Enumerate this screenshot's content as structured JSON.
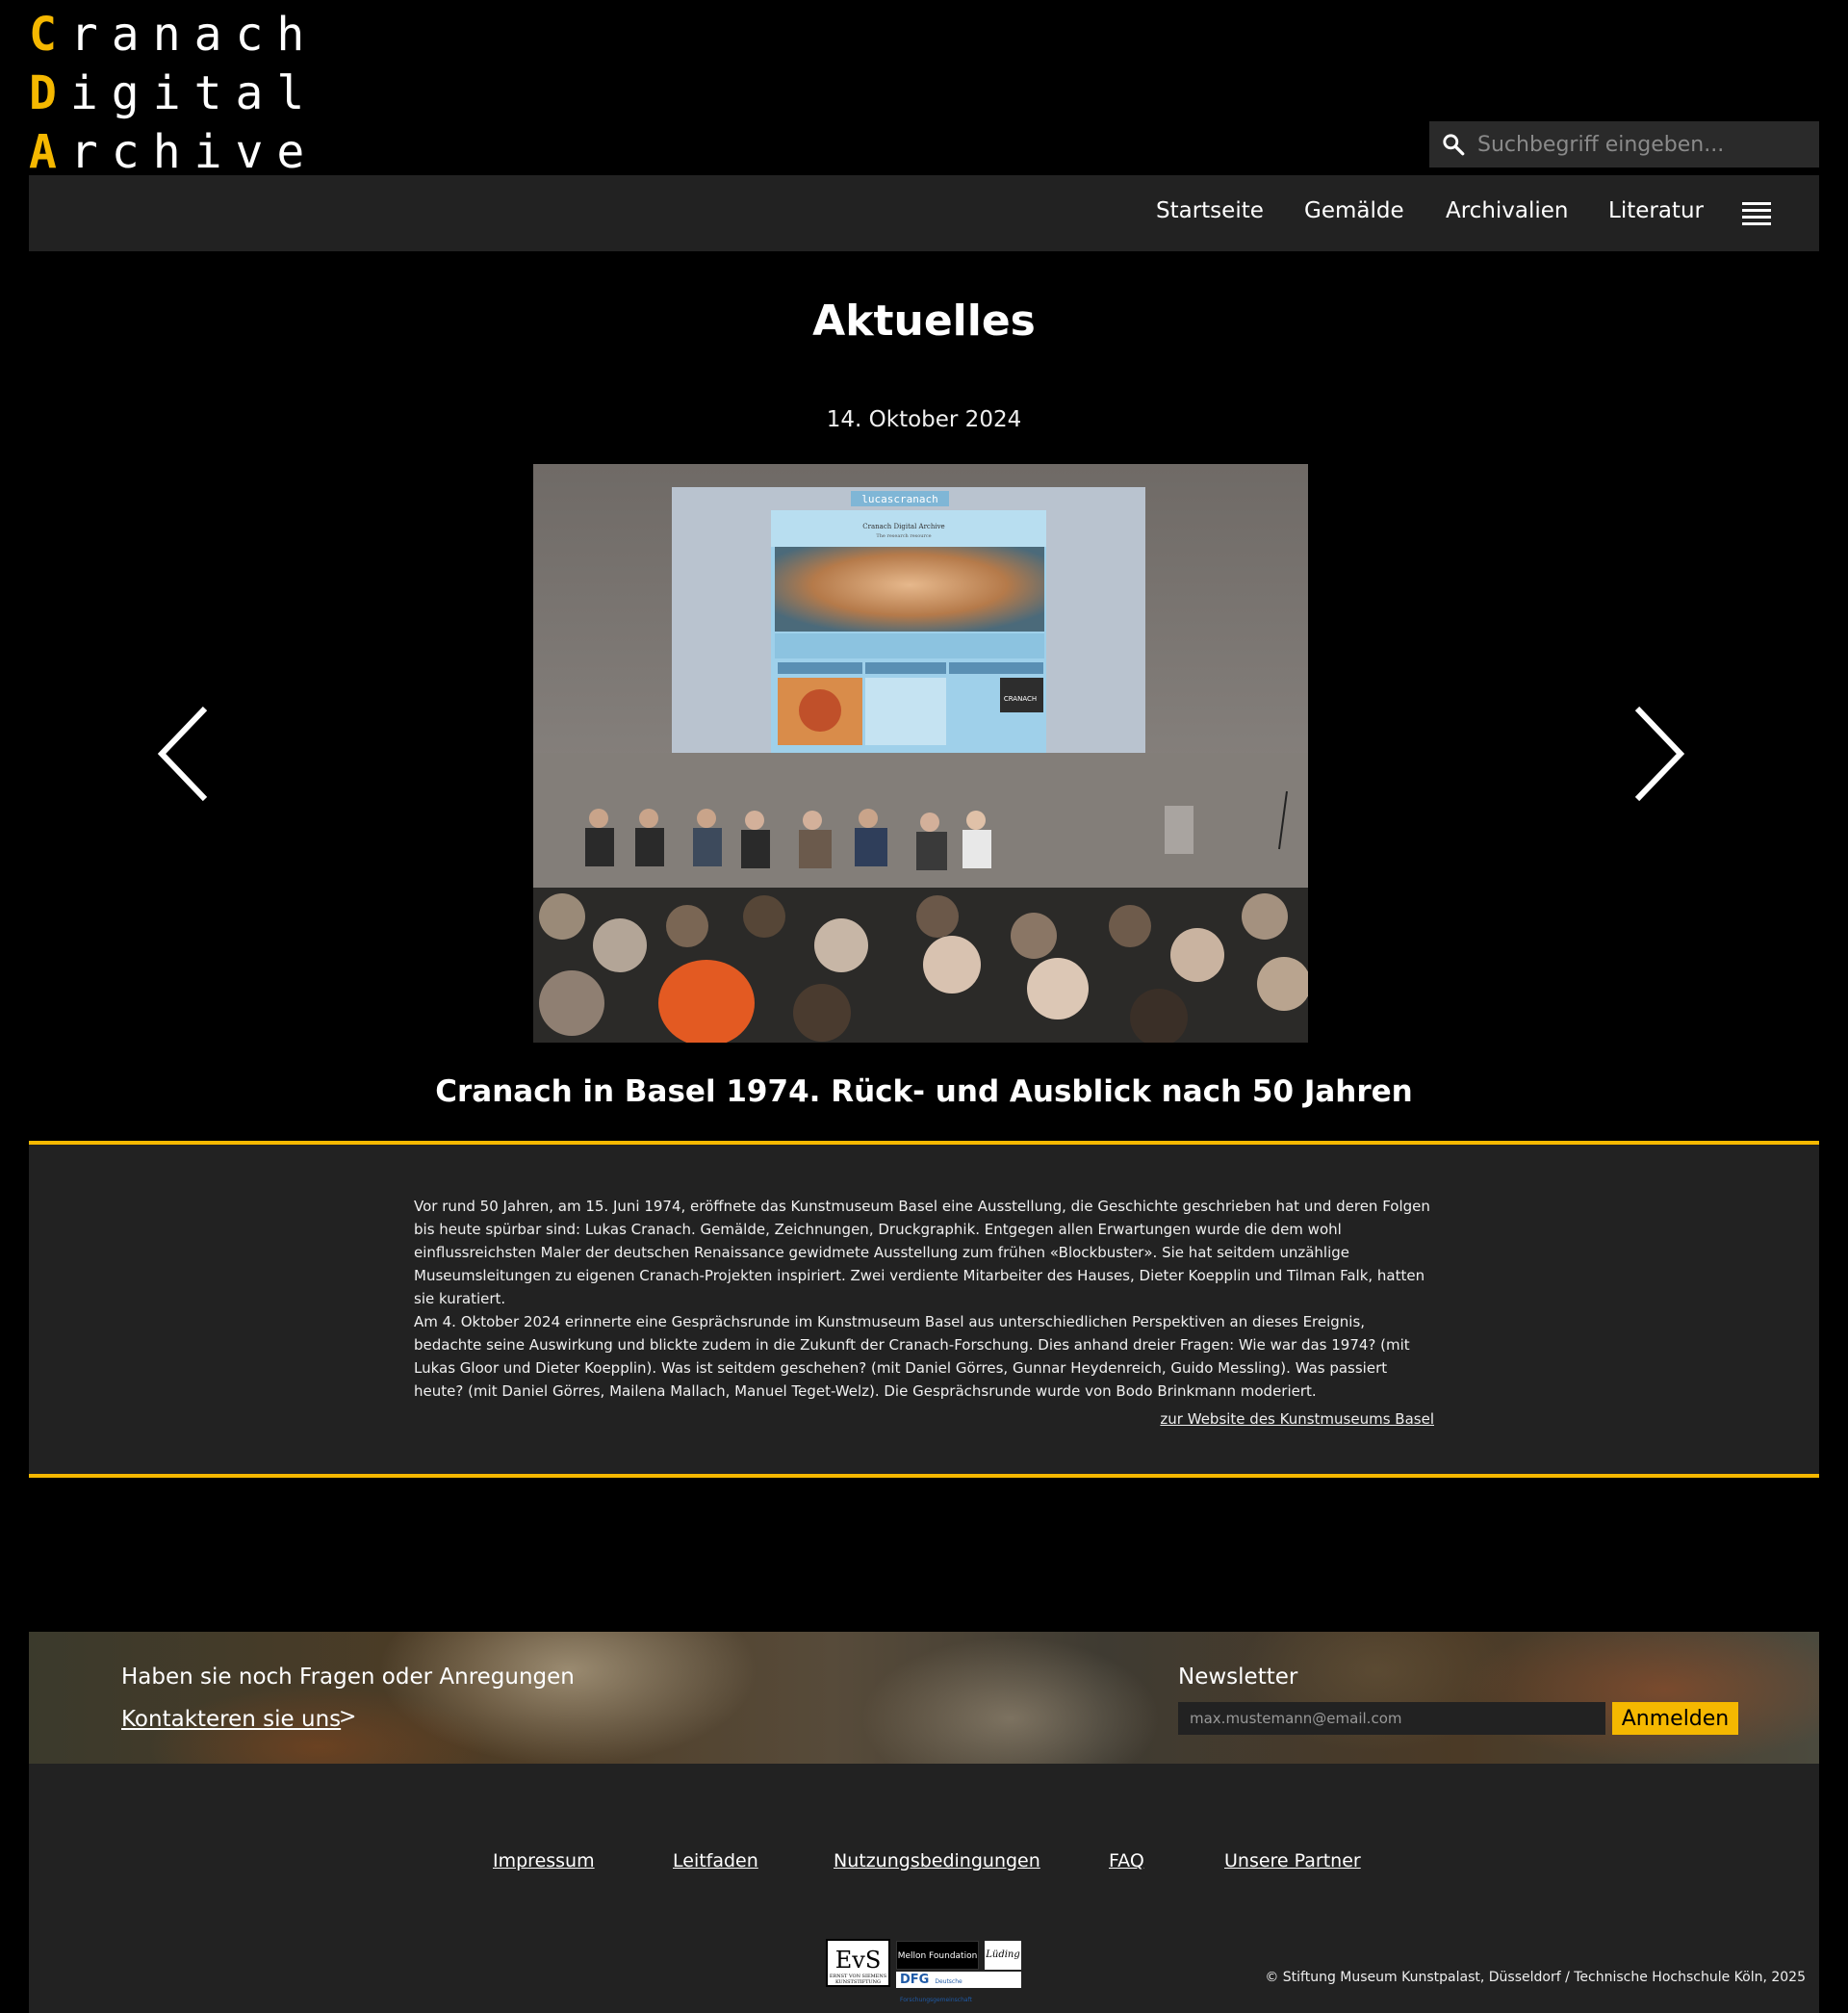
{
  "logo": {
    "line1": {
      "cap": "C",
      "rest": "ranach"
    },
    "line2": {
      "cap": "D",
      "rest": "igital"
    },
    "line3": {
      "cap": "A",
      "rest": "rchive"
    }
  },
  "search": {
    "placeholder": "Suchbegriff eingeben..."
  },
  "nav": {
    "items": [
      {
        "label": "Startseite"
      },
      {
        "label": "Gemälde"
      },
      {
        "label": "Archivalien"
      },
      {
        "label": "Literatur"
      }
    ]
  },
  "main": {
    "title": "Aktuelles",
    "date": "14. Oktober 2024",
    "article_title": "Cranach in Basel 1974. Rück- und Ausblick nach 50 Jahren",
    "paragraph1": "Vor rund 50 Jahren, am 15. Juni 1974, eröffnete das Kunstmuseum Basel eine  Ausstellung, die Geschichte geschrieben hat und deren Folgen bis heute  spürbar sind: Lukas Cranach. Gemälde, Zeichnungen, Druckgraphik. Entgegen allen Erwartungen wurde die dem wohl einflussreichsten Maler der deutschen Renaissance gewidmete Ausstellung zum frühen  «Blockbuster». Sie hat seitdem unzählige Museumsleitungen zu eigenen  Cranach-Projekten inspiriert. Zwei verdiente Mitarbeiter des Hauses,  Dieter Koepplin und Tilman Falk, hatten sie kuratiert.",
    "paragraph2": "Am 4. Oktober 2024 erinnerte eine Gesprächsrunde im Kunstmuseum Basel aus  unterschiedlichen Perspektiven an dieses Ereignis, bedachte seine Auswirkung und blickte zudem in die Zukunft der Cranach-Forschung. Dies  anhand dreier Fragen: Wie war das 1974? (mit Lukas Gloor und Dieter Koepplin). Was ist seitdem geschehen? (mit Daniel Görres, Gunnar  Heydenreich, Guido Messling). Was passiert heute? (mit Daniel Görres,  Mailena Mallach, Manuel Teget-Welz). Die Gesprächsrunde wurde von Bodo  Brinkmann moderiert.",
    "external_link": "zur Website des Kunstmuseums Basel",
    "photo_screen_text": {
      "site": "lucascranach",
      "header": "Cranach Digital Archive",
      "sub": "The research resource",
      "badge": "CRANACH"
    }
  },
  "banner": {
    "question": "Haben sie noch Fragen oder Anregungen",
    "contact_link": "Kontakteren sie uns",
    "chevron": ">",
    "newsletter_label": "Newsletter",
    "newsletter_placeholder": "max.mustemann@email.com",
    "newsletter_button": "Anmelden"
  },
  "footer": {
    "links": [
      {
        "label": "Impressum"
      },
      {
        "label": "Leitfaden"
      },
      {
        "label": "Nutzungsbedingungen"
      },
      {
        "label": "FAQ"
      },
      {
        "label": "Unsere Partner"
      }
    ],
    "copyright": "© Stiftung Museum Kunstpalast, Düsseldorf / Technische Hochschule Köln, 2025",
    "logos": {
      "evs": "EvS",
      "evs_sub": "ERNST VON SIEMENS KUNSTSTIFTUNG",
      "mellon": "Mellon Foundation",
      "dfg": "DFG",
      "dfg_sub": "Deutsche Forschungsgemeinschaft",
      "signature": "Lüding"
    }
  },
  "colors": {
    "accent": "#f5b800",
    "panel": "#222222",
    "background": "#000000"
  }
}
